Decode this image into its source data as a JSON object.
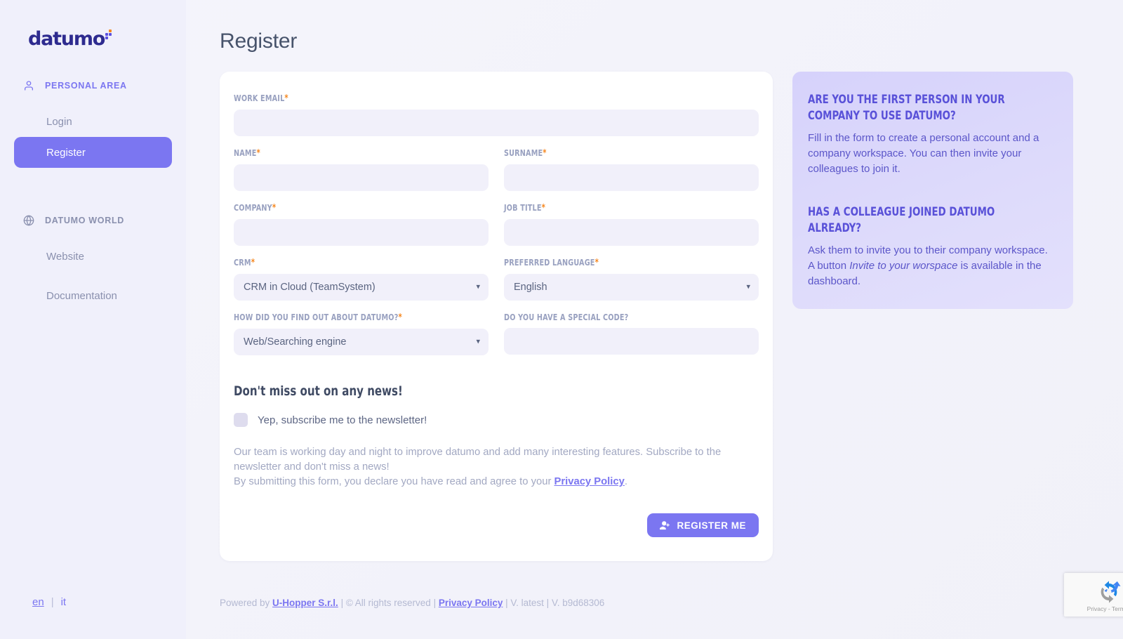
{
  "brand": {
    "logo_text": "datumo",
    "accent_purple": "#7b76f1",
    "accent_orange": "#f5871f",
    "logo_indigo": "#2e2b8f"
  },
  "sidebar": {
    "sections": [
      {
        "heading": "PERSONAL AREA",
        "icon": "user-icon",
        "items": [
          {
            "label": "Login",
            "active": false
          },
          {
            "label": "Register",
            "active": true
          }
        ]
      },
      {
        "heading": "DATUMO WORLD",
        "icon": "globe-icon",
        "items": [
          {
            "label": "Website",
            "active": false
          },
          {
            "label": "Documentation",
            "active": false
          }
        ]
      }
    ],
    "languages": {
      "active": "en",
      "separator": "|",
      "other": "it"
    }
  },
  "page": {
    "title": "Register"
  },
  "form": {
    "fields": {
      "work_email": {
        "label": "WORK EMAIL",
        "required": true,
        "value": "",
        "placeholder": ""
      },
      "name": {
        "label": "NAME",
        "required": true,
        "value": "",
        "placeholder": ""
      },
      "surname": {
        "label": "SURNAME",
        "required": true,
        "value": "",
        "placeholder": ""
      },
      "company": {
        "label": "COMPANY",
        "required": true,
        "value": "",
        "placeholder": ""
      },
      "job_title": {
        "label": "JOB TITLE",
        "required": true,
        "value": "",
        "placeholder": ""
      },
      "crm": {
        "label": "CRM",
        "required": true,
        "selected": "CRM in Cloud (TeamSystem)",
        "options": [
          "CRM in Cloud (TeamSystem)"
        ]
      },
      "preferred_language": {
        "label": "PREFERRED LANGUAGE",
        "required": true,
        "selected": "English",
        "options": [
          "English"
        ]
      },
      "find_out": {
        "label": "HOW DID YOU FIND OUT ABOUT DATUMO?",
        "required": true,
        "selected": "Web/Searching engine",
        "options": [
          "Web/Searching engine"
        ]
      },
      "special_code": {
        "label": "DO YOU HAVE A SPECIAL CODE?",
        "required": false,
        "value": "",
        "placeholder": ""
      }
    },
    "newsletter": {
      "title": "Don't miss out on any news!",
      "checkbox_label": "Yep, subscribe me to the newsletter!",
      "checked": false,
      "disclaimer_1": "Our team is working day and night to improve datumo and add many interesting features. Subscribe to the newsletter and don't miss a news!",
      "disclaimer_2_pre": "By submitting this form, you declare you have read and agree to your ",
      "disclaimer_2_link": "Privacy Policy",
      "disclaimer_2_post": "."
    },
    "submit": {
      "label": "REGISTER ME",
      "icon": "user-plus-icon"
    }
  },
  "info_panel": {
    "blocks": [
      {
        "heading": "ARE YOU THE FIRST PERSON IN YOUR COMPANY TO USE DATUMO?",
        "body": "Fill in the form to create a personal account and a company workspace. You can then invite your colleagues to join it."
      },
      {
        "heading": "HAS A COLLEAGUE JOINED DATUMO ALREADY?",
        "body_pre": "Ask them to invite you to their company workspace. A button ",
        "body_em": "Invite to your worspace",
        "body_post": " is available in the dashboard."
      }
    ]
  },
  "footer": {
    "powered_by": "Powered by ",
    "company_link": "U-Hopper S.r.l.",
    "rights": " | © All rights reserved | ",
    "privacy_link": "Privacy Policy",
    "version": " | V. latest | V. b9d68306"
  },
  "recaptcha": {
    "label": "Privacy - Termini",
    "icon": "recaptcha-icon"
  }
}
